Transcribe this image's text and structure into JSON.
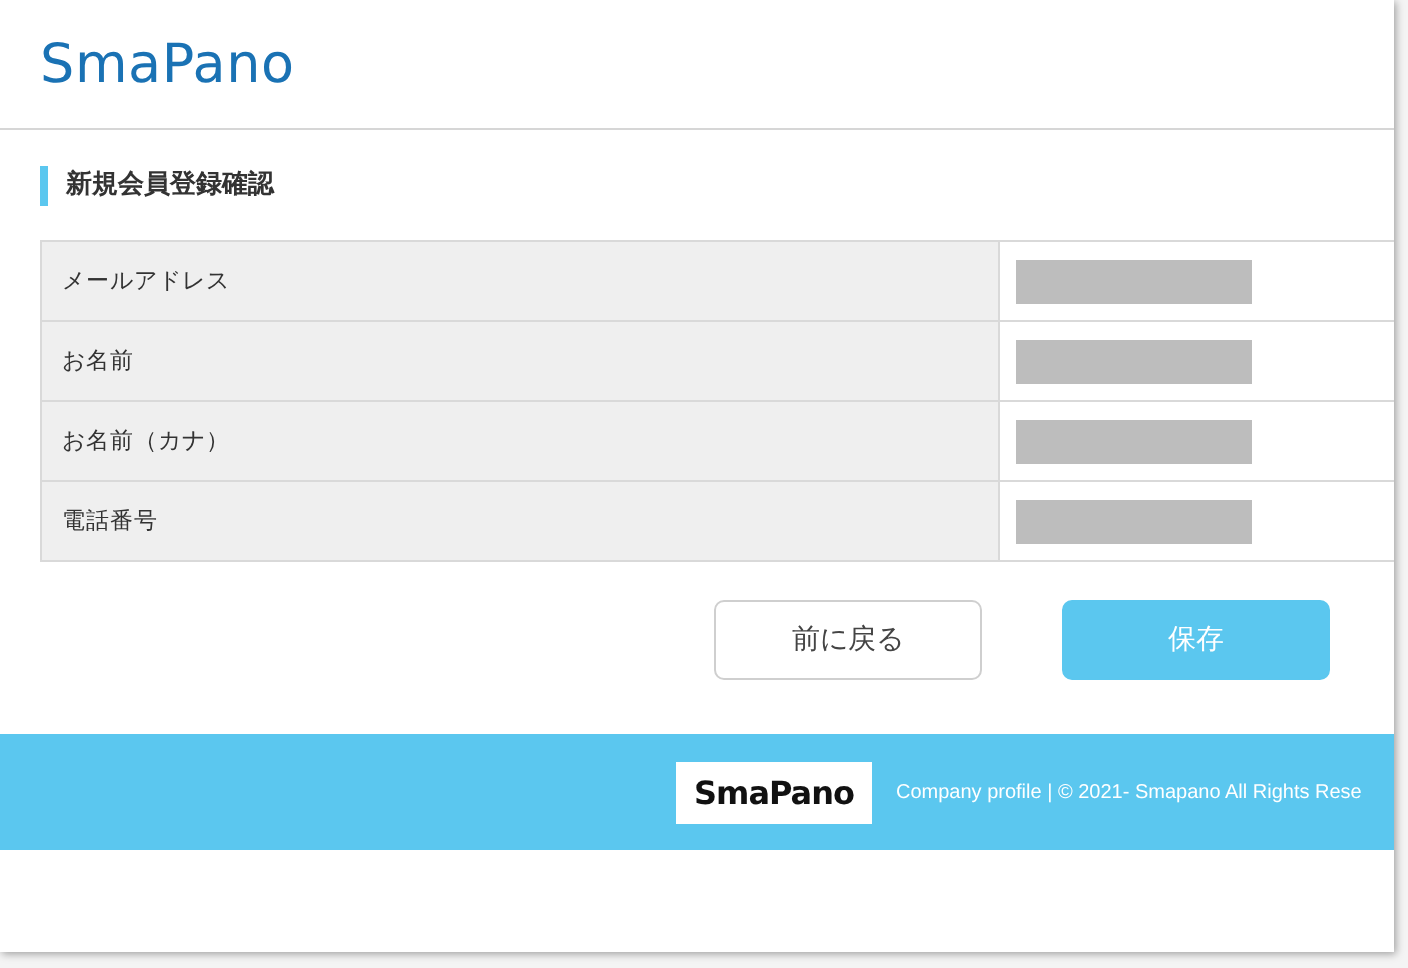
{
  "header": {
    "logo": "SmaPano"
  },
  "section": {
    "title": "新規会員登録確認"
  },
  "table": {
    "rows": [
      {
        "label": "メールアドレス",
        "value": {
          "kind": "redacted"
        }
      },
      {
        "label": "お名前",
        "value": {
          "kind": "redacted"
        }
      },
      {
        "label": "お名前（カナ）",
        "value": {
          "kind": "redacted"
        }
      },
      {
        "label": "電話番号",
        "value": {
          "kind": "redacted"
        }
      }
    ]
  },
  "buttons": [
    {
      "label": "前に戻る",
      "kind": "secondary"
    },
    {
      "label": "保存",
      "kind": "primary"
    }
  ],
  "footer": {
    "logo": "SmaPano",
    "text": "Company profile | © 2021- Smapano All Rights Rese"
  }
}
